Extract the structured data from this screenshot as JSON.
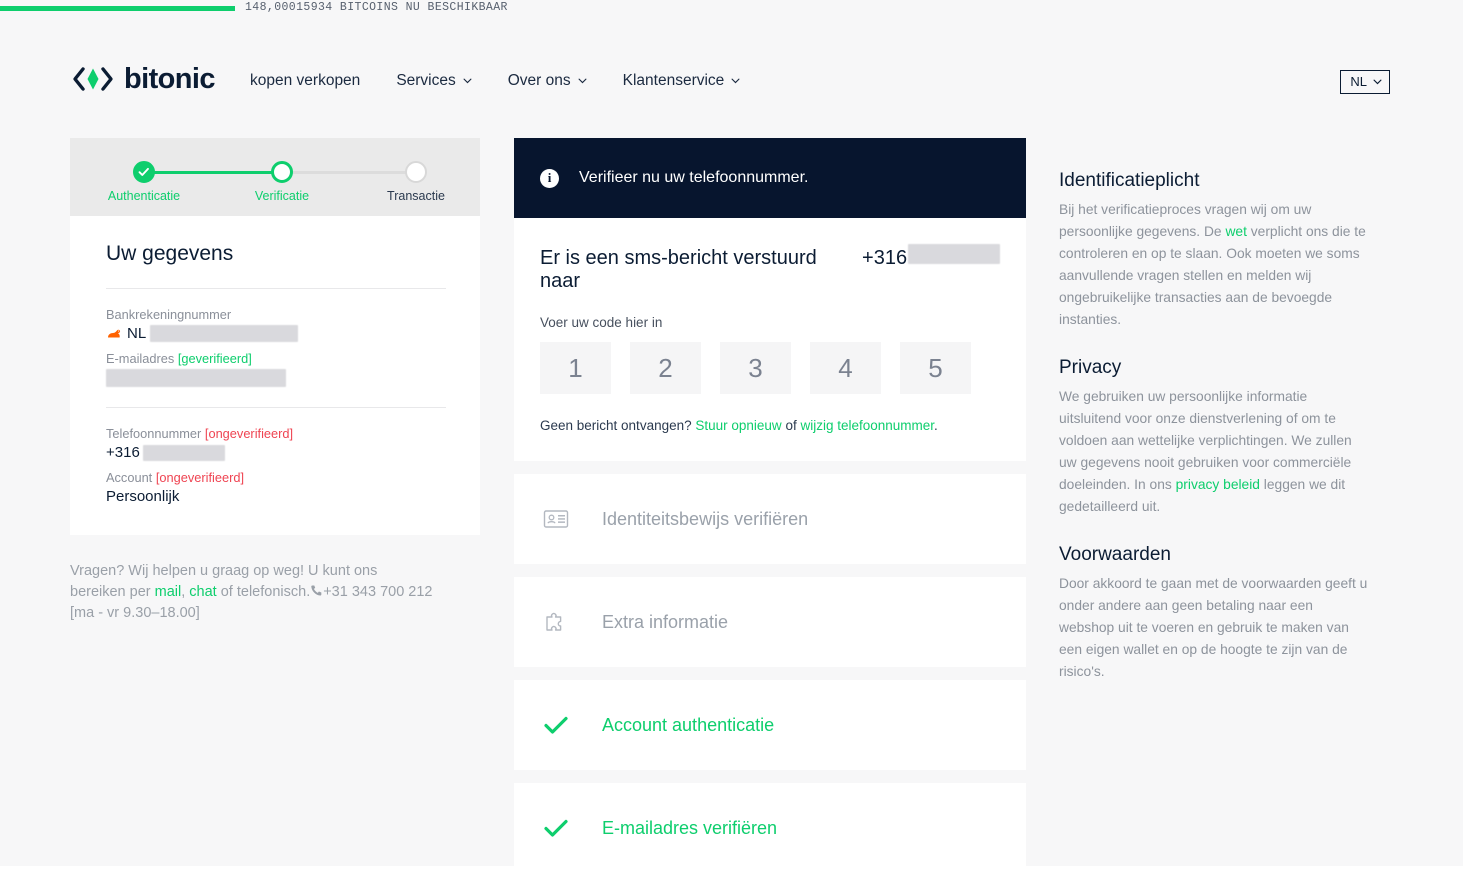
{
  "ticker": {
    "text": "148,00015934 BITCOINS NU BESCHIKBAAR"
  },
  "header": {
    "brand": "bitonic",
    "nav": [
      {
        "label": "kopen verkopen",
        "caret": false
      },
      {
        "label": "Services",
        "caret": true
      },
      {
        "label": "Over ons",
        "caret": true
      },
      {
        "label": "Klantenservice",
        "caret": true
      }
    ],
    "language": "NL"
  },
  "stepper": {
    "steps": [
      {
        "label": "Authenticatie",
        "state": "done"
      },
      {
        "label": "Verificatie",
        "state": "current"
      },
      {
        "label": "Transactie",
        "state": "todo"
      }
    ]
  },
  "details": {
    "title": "Uw gegevens",
    "bank_label": "Bankrekeningnummer",
    "bank_value": "NL",
    "bank_icon": "ing-lion-icon",
    "email_label": "E-mailadres",
    "email_status": "[geverifieerd]",
    "phone_label": "Telefoonnummer",
    "phone_status": "[ongeverifieerd]",
    "phone_value": "+316",
    "account_label": "Account",
    "account_status": "[ongeverifieerd]",
    "account_value": "Persoonlijk"
  },
  "help": {
    "line1": "Vragen? Wij helpen u graag op weg! U kunt ons",
    "line2_pre": "bereiken per ",
    "mail": "mail",
    "comma": ", ",
    "chat": "chat",
    "line2_post": " of telefonisch.",
    "phone": "+31 343 700 212",
    "hours": "[ma - vr 9.30–18.00]"
  },
  "banner": {
    "text": "Verifieer nu uw telefoonnummer."
  },
  "sms": {
    "heading": "Er is een sms-bericht verstuurd naar",
    "heading_number": "+316",
    "sub": "Voer uw code hier in",
    "code_placeholders": [
      "1",
      "2",
      "3",
      "4",
      "5"
    ],
    "resend_pre": "Geen bericht ontvangen? ",
    "resend_link": "Stuur opnieuw",
    "resend_mid": " of ",
    "change_link": "wijzig telefoonnummer",
    "resend_end": "."
  },
  "accordion": [
    {
      "label": "Identiteitsbewijs verifiëren",
      "icon": "id-card-icon",
      "state": "disabled"
    },
    {
      "label": "Extra informatie",
      "icon": "puzzle-piece-icon",
      "state": "disabled"
    },
    {
      "label": "Account authenticatie",
      "icon": "check-icon",
      "state": "done"
    },
    {
      "label": "E-mailadres verifiëren",
      "icon": "check-icon",
      "state": "done"
    }
  ],
  "aside": [
    {
      "heading": "Identificatieplicht",
      "pre": "Bij het verificatieproces vragen wij om uw persoonlijke gegevens. De ",
      "link": "wet",
      "post": " verplicht ons die te controleren en op te slaan. Ook moeten we soms aanvullende vragen stellen en melden wij ongebruikelijke transacties aan de bevoegde instanties."
    },
    {
      "heading": "Privacy",
      "pre": "We gebruiken uw persoonlijke informatie uitsluitend voor onze dienstverlening of om te voldoen aan wettelijke verplichtingen. We zullen uw gegevens nooit gebruiken voor commerciële doeleinden. In ons ",
      "link": "privacy beleid",
      "post": " leggen we dit gedetailleerd uit."
    },
    {
      "heading": "Voorwaarden",
      "pre": "Door akkoord te gaan met de voorwaarden geeft u onder andere aan geen betaling naar een webshop uit te voeren en gebruik te maken van een eigen wallet en op de hoogte te zijn van de risico's.",
      "link": "",
      "post": ""
    }
  ],
  "colors": {
    "accent": "#0ece6d",
    "dark": "#07152e",
    "danger": "#ef4452",
    "muted": "#8d939c"
  }
}
